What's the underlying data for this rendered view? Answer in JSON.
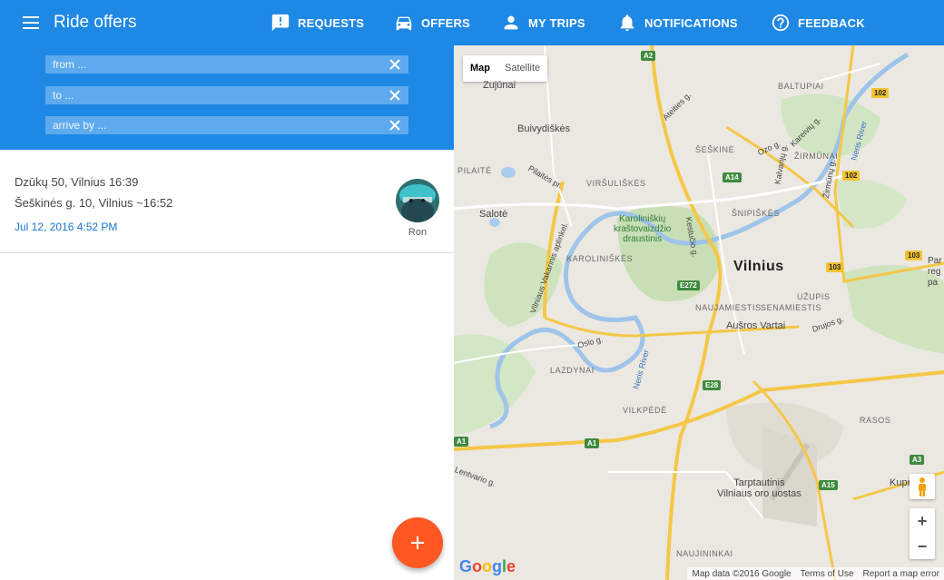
{
  "app": {
    "title": "Ride offers"
  },
  "nav": {
    "requests": "REQUESTS",
    "offers": "OFFERS",
    "my_trips": "MY TRIPS",
    "notifications": "NOTIFICATIONS",
    "feedback": "FEEDBACK"
  },
  "search": {
    "from_placeholder": "from ...",
    "to_placeholder": "to ...",
    "arrive_placeholder": "arrive by ..."
  },
  "offers": [
    {
      "from": "Dzūkų 50, Vilnius 16:39",
      "to": "Šeškinės g. 10, Vilnius ~16:52",
      "posted": "Jul 12, 2016 4:52 PM",
      "driver": "Ron"
    }
  ],
  "map": {
    "type_map": "Map",
    "type_satellite": "Satellite",
    "city": "Vilnius",
    "labels": {
      "zujunai": "Zujūnai",
      "buivydiskes": "Buivydiškės",
      "pilaite": "PILAITĖ",
      "salote": "Salotė",
      "virsuliskes": "VIRŠULIŠKĖS",
      "karoliniskes": "KAROLINIŠKĖS",
      "park": "Karoliniškių\nkraštovaizdžio\ndraustinis",
      "seskine": "ŠEŠKINĖ",
      "zirmunai": "ŽIRMŪNAI",
      "baltupiai": "BALTUPIAI",
      "snipiskes": "ŠNIPIŠKĖS",
      "naujamiestis": "NAUJAMIESTIS",
      "senamiestis": "SENAMIESTIS",
      "uzupis": "UŽUPIS",
      "ausros": "Aušros Vartai",
      "lazdynai": "LAZDYNAI",
      "vilpede": "VILKPĖDĖ",
      "rasos": "RASOS",
      "airport": "Tarptautinis\nVilniaus oro uostas",
      "naujininkai": "NAUJININKAI",
      "kuprioniskes": "Kuprioniš",
      "neris": "Neris River",
      "oslo": "Oslo g.",
      "ozo": "Ozo g.",
      "lentvario": "Lentvario g.",
      "atetes": "Ateities g.",
      "kalvariju": "Kalvarijų g.",
      "zirmunu": "Žirmūnų g.",
      "kareiviu": "Kareivių g.",
      "kestucio": "Kestučio g.",
      "drujos": "Drujos g.",
      "pilaites": "Pilaitės pr.",
      "vakarinis": "Vilniaus Vakarinis aplinkel.",
      "pare_r": "Par\nreg\npa"
    },
    "shields": {
      "a2": "A2",
      "a14": "A14",
      "e272": "E272",
      "e28": "E28",
      "a1": "A1",
      "a1b": "A1",
      "a15": "A15",
      "a3": "A3",
      "r102": "102",
      "r102b": "102",
      "r103": "103",
      "r103b": "103"
    },
    "attribution": {
      "data": "Map data ©2016 Google",
      "terms": "Terms of Use",
      "report": "Report a map error"
    },
    "logo": "Google"
  },
  "colors": {
    "primary": "#1e88e5",
    "field": "#5eaaee",
    "fab": "#ff5722",
    "link": "#1976d2"
  }
}
